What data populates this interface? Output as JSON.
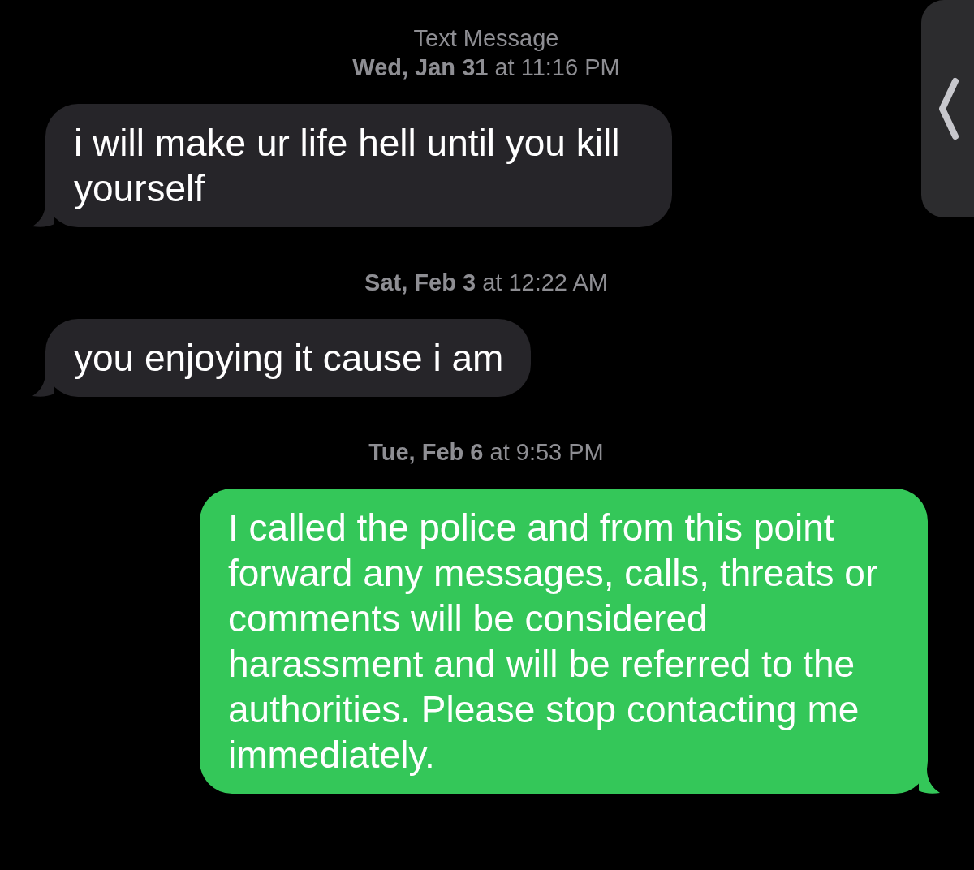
{
  "conversation": {
    "entries": [
      {
        "kind": "service",
        "text": "Text Message"
      },
      {
        "kind": "timestamp",
        "text": "**Wed, Jan 31** at 11:16 PM"
      },
      {
        "kind": "incoming",
        "text": "i will make ur life hell until you kill yourself"
      },
      {
        "kind": "timestamp",
        "text": "**Sat, Feb 3** at 12:22 AM"
      },
      {
        "kind": "incoming",
        "text": "you enjoying it cause i am"
      },
      {
        "kind": "timestamp",
        "text": "**Tue, Feb 6** at 9:53 PM"
      },
      {
        "kind": "outgoing",
        "text": "I called the police and from this point forward any messages, calls, threats or comments will be considered harassment and will be referred to the authorities. Please stop contacting me immediately."
      }
    ]
  }
}
